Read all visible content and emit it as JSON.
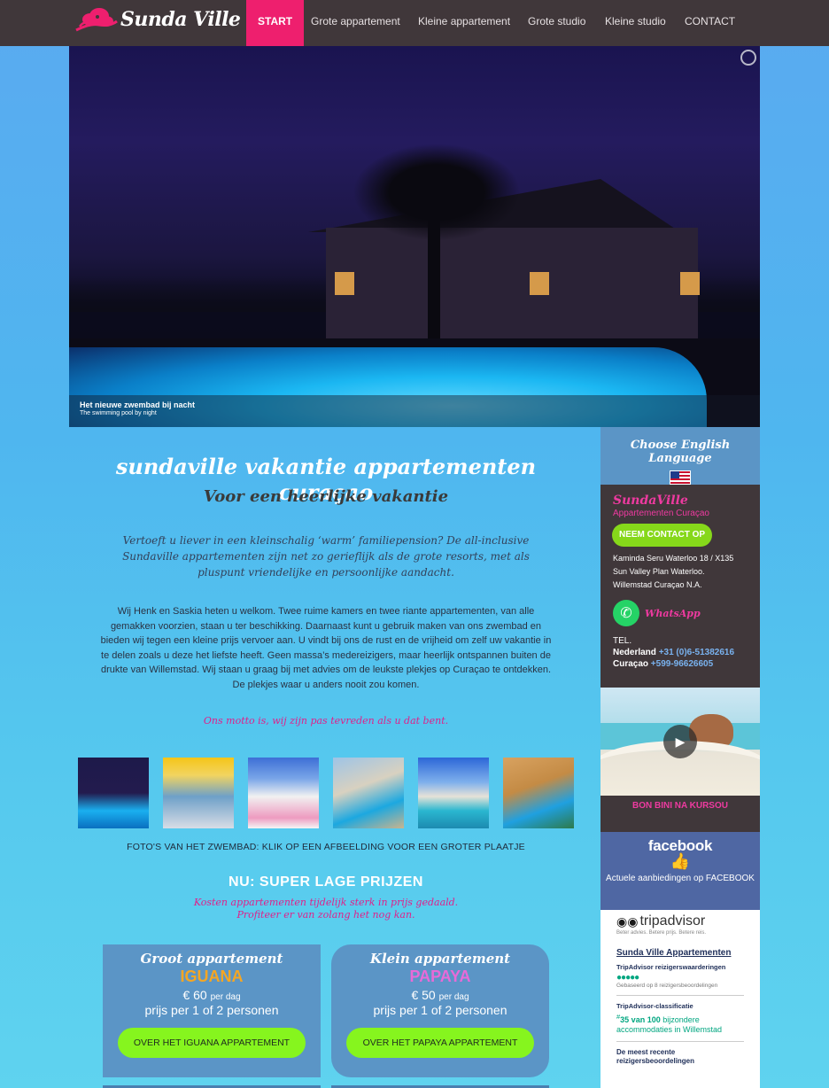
{
  "brand": {
    "logo_text": "Sunda Ville"
  },
  "nav": {
    "items": [
      {
        "label": "START",
        "active": true
      },
      {
        "label": "Grote appartement"
      },
      {
        "label": "Kleine appartement"
      },
      {
        "label": "Grote studio"
      },
      {
        "label": "Kleine studio"
      },
      {
        "label": "CONTACT"
      }
    ]
  },
  "hero": {
    "caption_title": "Het nieuwe zwembad bij nacht",
    "caption_sub": "The swimming pool by night"
  },
  "main": {
    "title": "sundaville vakantie appartementen curaçao",
    "subtitle": "Voor een heerlijke vakantie",
    "intro": "Vertoeft u liever in een kleinschalig ‘warm’ familiepension? De all-inclusive Sundaville appartementen zijn net zo gerieflijk als de grote resorts, met als pluspunt vriendelijke en persoonlijke aandacht.",
    "welcome": "Wij Henk en Saskia heten u welkom. Twee ruime kamers en twee riante appartementen, van alle gemakken voorzien, staan u ter beschikking. Daarnaast kunt u gebruik maken van ons zwembad en bieden wij tegen een kleine prijs vervoer aan. U vindt bij ons de rust en de vrijheid om zelf uw vakantie in te delen zoals u deze het liefste heeft. Geen massa’s medereizigers, maar heerlijk ontspannen buiten de drukte van Willemstad. Wij staan u graag bij met advies om de leukste plekjes op Curaçao te ontdekken. De plekjes waar u anders nooit zou komen.",
    "motto": "Ons motto is, wij zijn pas tevreden als u dat bent.",
    "photo_caption": "FOTO'S VAN HET ZWEMBAD: KLIK OP EEN AFBEELDING VOOR EEN GROTER PLAATJE",
    "promo_title": "NU: SUPER LAGE PRIJZEN",
    "promo_line1": "Kosten appartementen tijdelijk sterk in prijs gedaald.",
    "promo_line2": "Profiteer er van zolang het nog kan."
  },
  "cards": [
    {
      "title": "Groot appartement",
      "name": "IGUANA",
      "name_color": "#f5a623",
      "price": "€ 60",
      "per": "per dag",
      "persons": "prijs per 1 of 2 personen",
      "button": "OVER HET IGUANA APPARTEMENT"
    },
    {
      "title": "Klein appartement",
      "name": "PAPAYA",
      "name_color": "#e86ad8",
      "price": "€ 50",
      "per": "per dag",
      "persons": "prijs per 1 of 2 personen",
      "button": "OVER HET PAPAYA APPARTEMENT"
    }
  ],
  "sidebar": {
    "lang_title": "Choose English Language",
    "brand": "SundaVille",
    "brand_sub": "Appartementen Curaçao",
    "contact_button": "NEEM CONTACT OP",
    "address": [
      "Kaminda Seru Waterloo 18 / X135",
      "Sun Valley Plan Waterloo.",
      "Willemstad Curaçao N.A."
    ],
    "whatsapp": "WhatsApp",
    "tel_label": "TEL.",
    "tel_nl_label": "Nederland",
    "tel_nl": "+31 (0)6-51382616",
    "tel_cw_label": "Curaçao",
    "tel_cw": "+599-96626605",
    "video_label": "BON BINI NA KURSOU",
    "fb_word": "facebook",
    "fb_text": "Actuele aanbiedingen op FACEBOOK",
    "ta_word": "tripadvisor",
    "ta_tag": "Beter advies. Betere prijs. Betere reis.",
    "ta_name": "Sunda Ville Appartementen",
    "ta_sub": "TripAdvisor reizigerswaarderingen",
    "ta_based": "Gebaseerd op 8 reizigersbeoordelingen",
    "ta_class": "TripAdvisor-classificatie",
    "ta_rank_num": "35 van 100",
    "ta_rank_text": "bijzondere accommodaties in Willemstad",
    "ta_recent": "De meest recente reizigersbeoordelingen"
  }
}
